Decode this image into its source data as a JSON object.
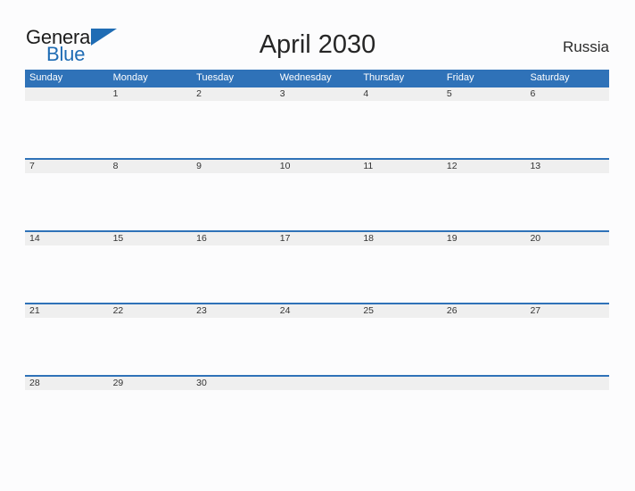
{
  "page": {
    "background_color": "#fcfcfd"
  },
  "brand": {
    "name_part1": "General",
    "name_part2": "Blue",
    "primary_color": "#1f6cb4",
    "flag_icon": "blue-triangle-flag-icon"
  },
  "header": {
    "title": "April 2030",
    "country": "Russia"
  },
  "calendar": {
    "month": "April",
    "year": "2030",
    "header_color": "#2f72b8",
    "date_band_color": "#efefef",
    "weekdays": [
      "Sunday",
      "Monday",
      "Tuesday",
      "Wednesday",
      "Thursday",
      "Friday",
      "Saturday"
    ],
    "weeks": [
      [
        "",
        "1",
        "2",
        "3",
        "4",
        "5",
        "6"
      ],
      [
        "7",
        "8",
        "9",
        "10",
        "11",
        "12",
        "13"
      ],
      [
        "14",
        "15",
        "16",
        "17",
        "18",
        "19",
        "20"
      ],
      [
        "21",
        "22",
        "23",
        "24",
        "25",
        "26",
        "27"
      ],
      [
        "28",
        "29",
        "30",
        "",
        "",
        "",
        ""
      ]
    ]
  }
}
